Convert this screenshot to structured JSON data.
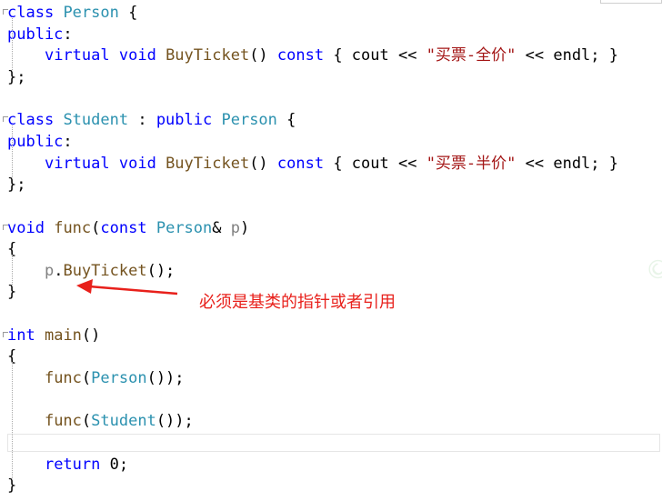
{
  "colors": {
    "keyword": "#0000ff",
    "type_name": "#2b91af",
    "function_name": "#74531f",
    "string": "#a31515",
    "parameter": "#808080",
    "plain": "#000000",
    "annotation": "#e8201b"
  },
  "code": {
    "lines": [
      [
        {
          "t": "class",
          "c": "keyword"
        },
        {
          "t": " "
        },
        {
          "t": "Person",
          "c": "type_name"
        },
        {
          "t": " {"
        }
      ],
      [
        {
          "t": "public",
          "c": "keyword"
        },
        {
          "t": ":"
        }
      ],
      [
        {
          "t": "    "
        },
        {
          "t": "virtual",
          "c": "keyword"
        },
        {
          "t": " "
        },
        {
          "t": "void",
          "c": "keyword"
        },
        {
          "t": " "
        },
        {
          "t": "BuyTicket",
          "c": "function_name"
        },
        {
          "t": "() "
        },
        {
          "t": "const",
          "c": "keyword"
        },
        {
          "t": " { cout << "
        },
        {
          "t": "\"买票-全价\"",
          "c": "string"
        },
        {
          "t": " << endl; }"
        }
      ],
      [
        {
          "t": "};"
        }
      ],
      [],
      [
        {
          "t": "class",
          "c": "keyword"
        },
        {
          "t": " "
        },
        {
          "t": "Student",
          "c": "type_name"
        },
        {
          "t": " : "
        },
        {
          "t": "public",
          "c": "keyword"
        },
        {
          "t": " "
        },
        {
          "t": "Person",
          "c": "type_name"
        },
        {
          "t": " {"
        }
      ],
      [
        {
          "t": "public",
          "c": "keyword"
        },
        {
          "t": ":"
        }
      ],
      [
        {
          "t": "    "
        },
        {
          "t": "virtual",
          "c": "keyword"
        },
        {
          "t": " "
        },
        {
          "t": "void",
          "c": "keyword"
        },
        {
          "t": " "
        },
        {
          "t": "BuyTicket",
          "c": "function_name"
        },
        {
          "t": "() "
        },
        {
          "t": "const",
          "c": "keyword"
        },
        {
          "t": " { cout << "
        },
        {
          "t": "\"买票-半价\"",
          "c": "string"
        },
        {
          "t": " << endl; }"
        }
      ],
      [
        {
          "t": "};"
        }
      ],
      [],
      [
        {
          "t": "void",
          "c": "keyword"
        },
        {
          "t": " "
        },
        {
          "t": "func",
          "c": "function_name"
        },
        {
          "t": "("
        },
        {
          "t": "const",
          "c": "keyword"
        },
        {
          "t": " "
        },
        {
          "t": "Person",
          "c": "type_name"
        },
        {
          "t": "& "
        },
        {
          "t": "p",
          "c": "parameter"
        },
        {
          "t": ")"
        }
      ],
      [
        {
          "t": "{"
        }
      ],
      [
        {
          "t": "    "
        },
        {
          "t": "p",
          "c": "parameter"
        },
        {
          "t": "."
        },
        {
          "t": "BuyTicket",
          "c": "function_name"
        },
        {
          "t": "();"
        }
      ],
      [
        {
          "t": "}"
        }
      ],
      [],
      [
        {
          "t": "int",
          "c": "keyword"
        },
        {
          "t": " "
        },
        {
          "t": "main",
          "c": "function_name"
        },
        {
          "t": "()"
        }
      ],
      [
        {
          "t": "{"
        }
      ],
      [
        {
          "t": "    "
        },
        {
          "t": "func",
          "c": "function_name"
        },
        {
          "t": "("
        },
        {
          "t": "Person",
          "c": "type_name"
        },
        {
          "t": "());"
        }
      ],
      [],
      [
        {
          "t": "    "
        },
        {
          "t": "func",
          "c": "function_name"
        },
        {
          "t": "("
        },
        {
          "t": "Student",
          "c": "type_name"
        },
        {
          "t": "());"
        }
      ],
      [],
      [
        {
          "t": "    "
        },
        {
          "t": "return",
          "c": "keyword"
        },
        {
          "t": " 0;"
        }
      ],
      [
        {
          "t": "}"
        }
      ]
    ]
  },
  "annotation": {
    "text": "必须是基类的指针或者引用"
  }
}
